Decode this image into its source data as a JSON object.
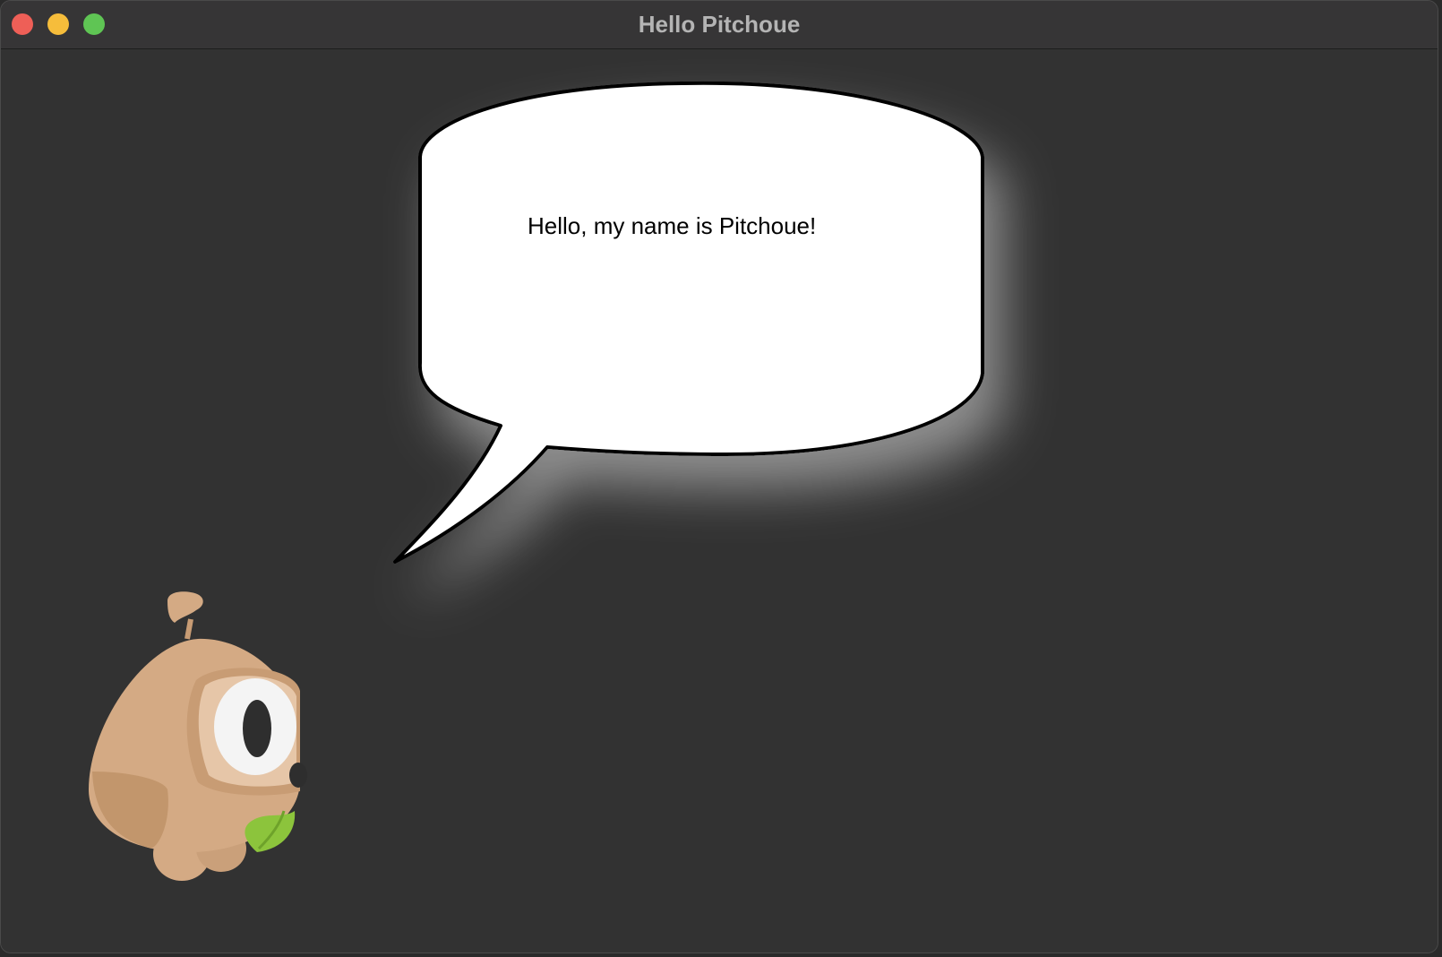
{
  "window": {
    "title": "Hello Pitchoue"
  },
  "speech_bubble": {
    "text": "Hello, my name is Pitchoue!"
  },
  "colors": {
    "window_bg": "#323232",
    "titlebar_bg": "#363536",
    "close": "#ee5f57",
    "minimize": "#f6bd3b",
    "zoom": "#5fc554",
    "bubble_fill": "#ffffff",
    "mascot_body": "#d4aa84",
    "leaf": "#8cc43c"
  },
  "icons": {
    "mascot": "pitchoue-sloth-icon",
    "leaf": "leaf-icon"
  }
}
